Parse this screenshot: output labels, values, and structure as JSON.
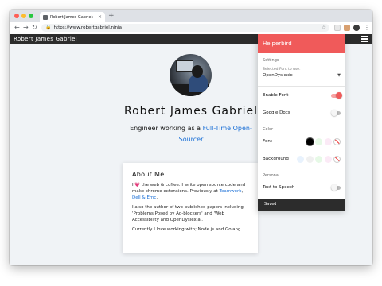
{
  "browser": {
    "tab_title": "Robert James Gabriel: Softw...",
    "tab_close": "×",
    "new_tab": "+",
    "url": "https://www.robertgabriel.ninja",
    "back": "←",
    "forward": "→",
    "reload": "↻",
    "lock": "🔒",
    "bookmark": "☆",
    "menu": "⋮"
  },
  "site": {
    "brand": "Robert James Gabriel",
    "name": "Robert James Gabriel",
    "tagline_prefix": "Engineer working as a ",
    "tagline_link": "Full-Time Open-Sourcer",
    "about": {
      "title": "About Me",
      "p1_a": "I ",
      "p1_heart": "💗",
      "p1_b": " the web & coffee. I write open source code and make chrome extensions. Previously at ",
      "p1_link1": "Teamwork",
      "p1_sep": ", ",
      "p1_link2": "Dell & Emc",
      "p1_end": ".",
      "p2": "I also the author of two published papers including 'Problems Posed by Ad-blockers' and 'Web Accessibility and OpenDyslexia'.",
      "p3": "Currently I love working with; Node.js and Golang."
    }
  },
  "helperbird": {
    "title": "Helperbird",
    "settings_label": "Settings",
    "font_select_label": "Selected Font to use.",
    "font_value": "OpenDyslexic",
    "enable_font_label": "Enable Font",
    "enable_font_on": true,
    "google_docs_label": "Google Docs",
    "google_docs_on": false,
    "color_section": "Color",
    "font_color_label": "Font",
    "background_label": "Background",
    "font_swatches": [
      "#000000",
      "#e6f9e6",
      "#fbeaf6",
      "none"
    ],
    "background_swatches": [
      "#e8f2fd",
      "#f0f0f0",
      "#e6f9e6",
      "#fbeaf6",
      "none"
    ],
    "personal_section": "Personal",
    "tts_label": "Text to Speech",
    "status": "Saved",
    "accent": "#f05a5a"
  }
}
